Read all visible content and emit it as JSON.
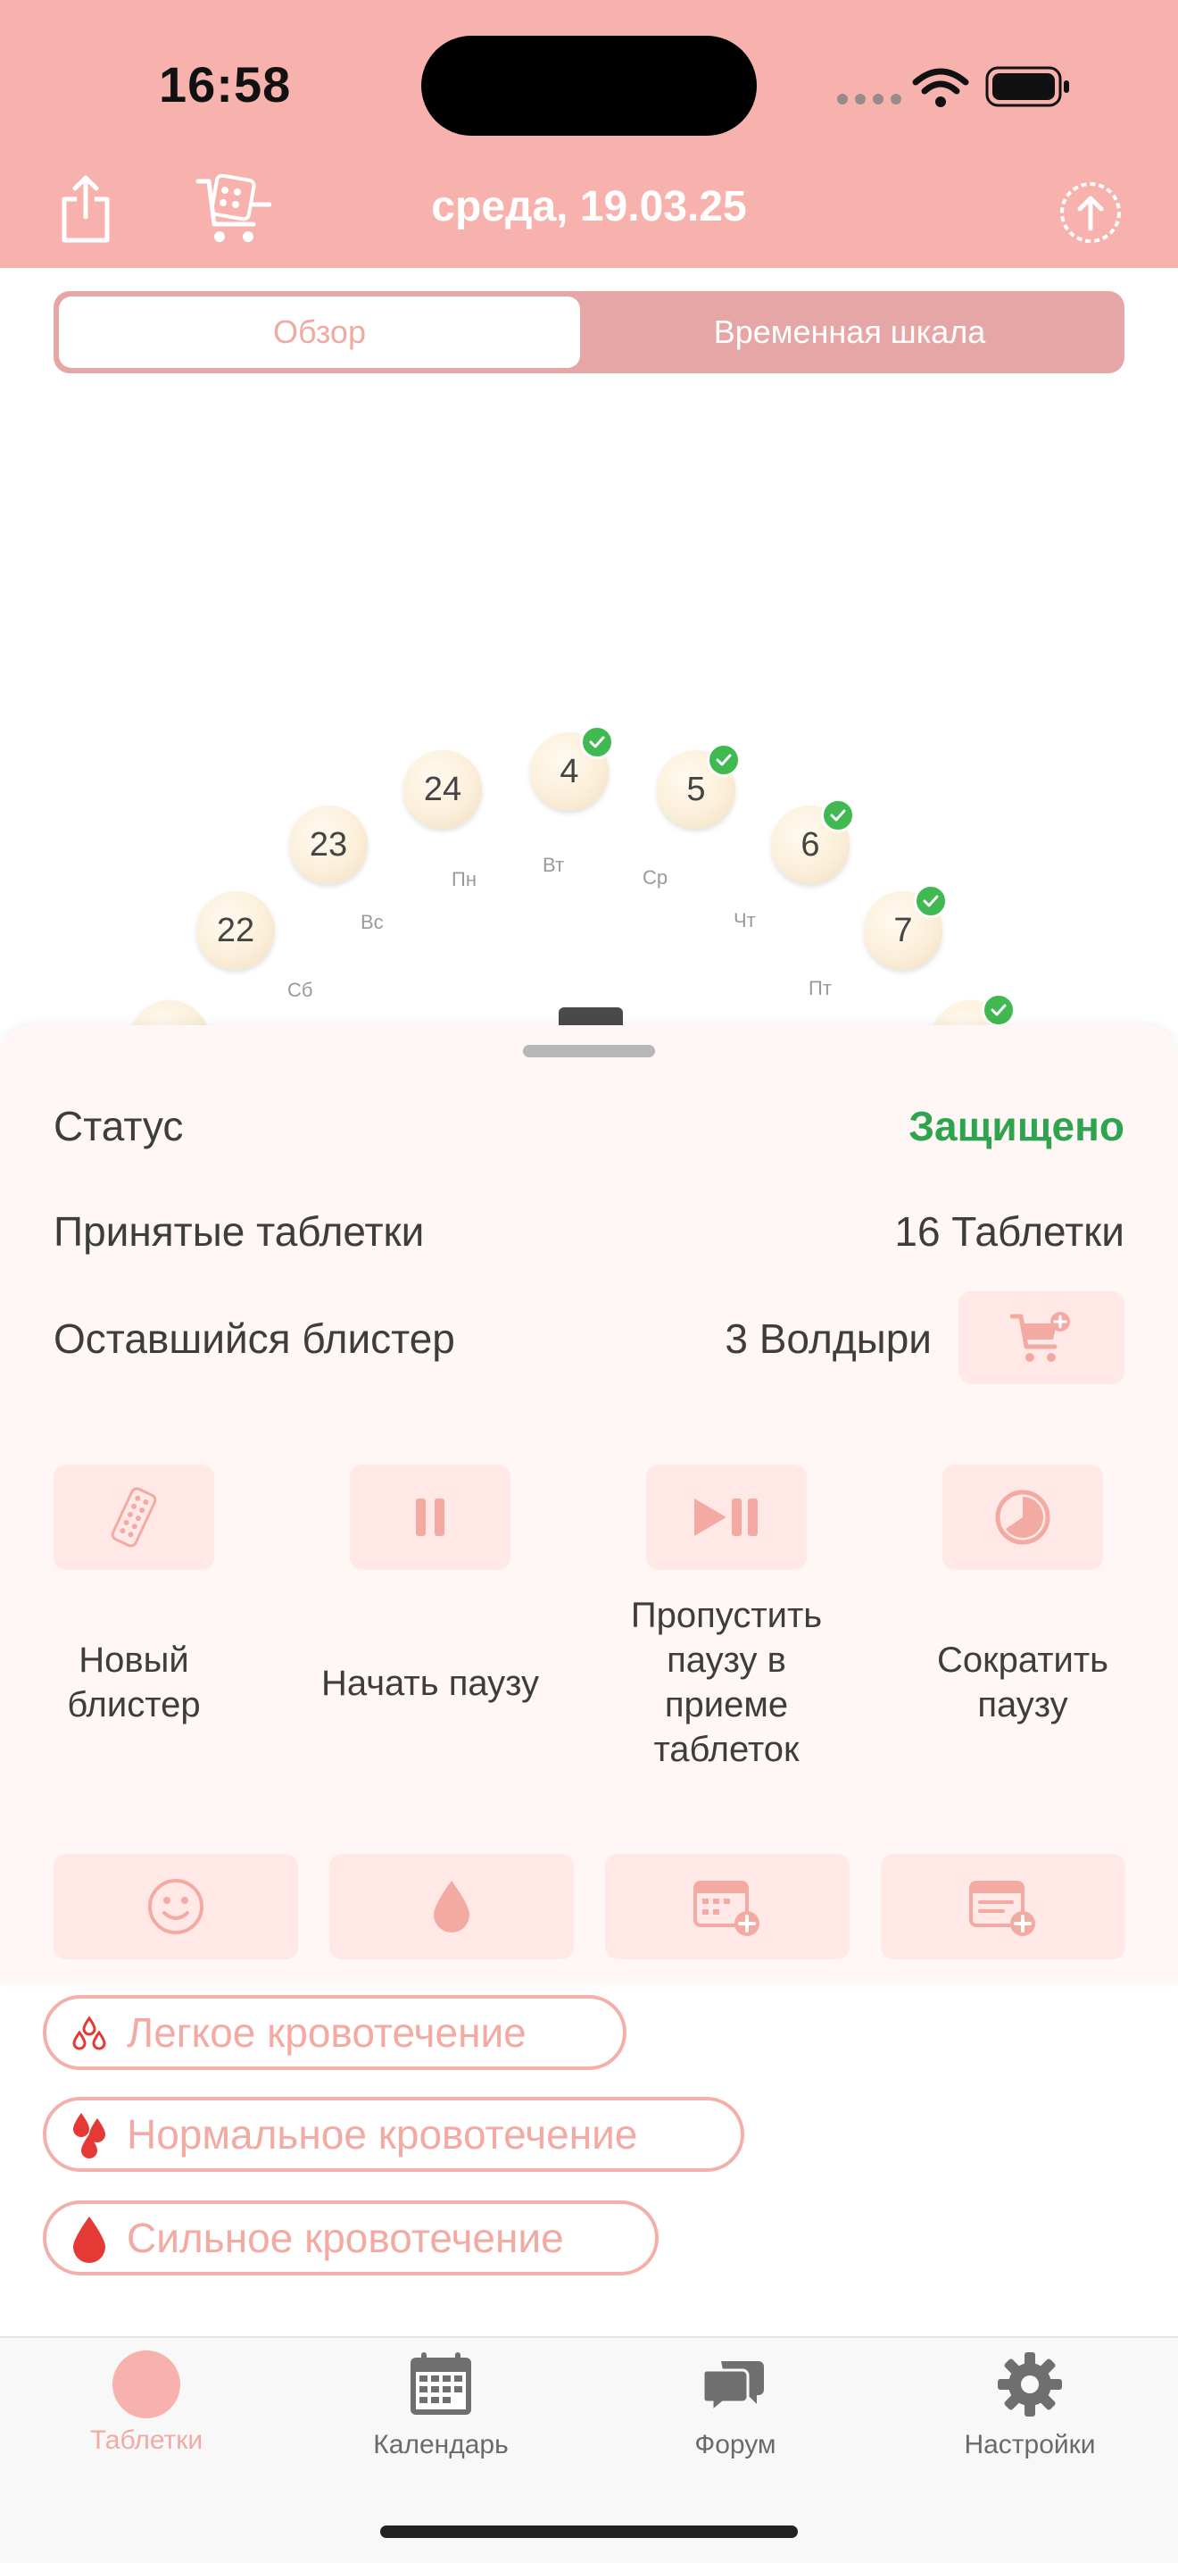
{
  "status_bar": {
    "time": "16:58"
  },
  "header": {
    "date": "среда, 19.03.25"
  },
  "segment": {
    "overview": "Обзор",
    "timeline": "Временная шкала"
  },
  "pill_ring": {
    "pills": [
      {
        "label": "22",
        "taken": false
      },
      {
        "label": "23",
        "taken": false
      },
      {
        "label": "24",
        "taken": false
      },
      {
        "label": "4",
        "taken": true
      },
      {
        "label": "5",
        "taken": true
      },
      {
        "label": "6",
        "taken": true
      },
      {
        "label": "7",
        "taken": true
      }
    ],
    "days": [
      "Сб",
      "Вс",
      "Пн",
      "Вт",
      "Ср",
      "Чт",
      "Пт"
    ]
  },
  "summary": {
    "status_label": "Статус",
    "status_value": "Защищено",
    "status_color": "#2ea44f",
    "taken_label": "Принятые таблетки",
    "taken_value": "16 Таблетки",
    "remaining_label": "Оставшийся блистер",
    "remaining_value": "3 Волдыри"
  },
  "actions": [
    {
      "icon": "blister-icon",
      "label": "Новый блистер"
    },
    {
      "icon": "pause-icon",
      "label": "Начать паузу"
    },
    {
      "icon": "play-pause-icon",
      "label": "Пропустить паузу в приеме таблеток"
    },
    {
      "icon": "pie-clock-icon",
      "label": "Сократить паузу"
    }
  ],
  "quick_icons": [
    "smiley-icon",
    "drop-icon",
    "calendar-add-icon",
    "note-add-icon"
  ],
  "bleeding": {
    "light": "Легкое кровотечение",
    "normal": "Нормальное кровотечение",
    "heavy": "Сильное кровотечение"
  },
  "tabs": [
    {
      "label": "Таблетки",
      "active": true
    },
    {
      "label": "Календарь",
      "active": false
    },
    {
      "label": "Форум",
      "active": false
    },
    {
      "label": "Настройки",
      "active": false
    }
  ],
  "colors": {
    "accent": "#f7b2ad",
    "tile": "#ffe8e6",
    "check": "#3fb950",
    "blood": "#e53935"
  }
}
